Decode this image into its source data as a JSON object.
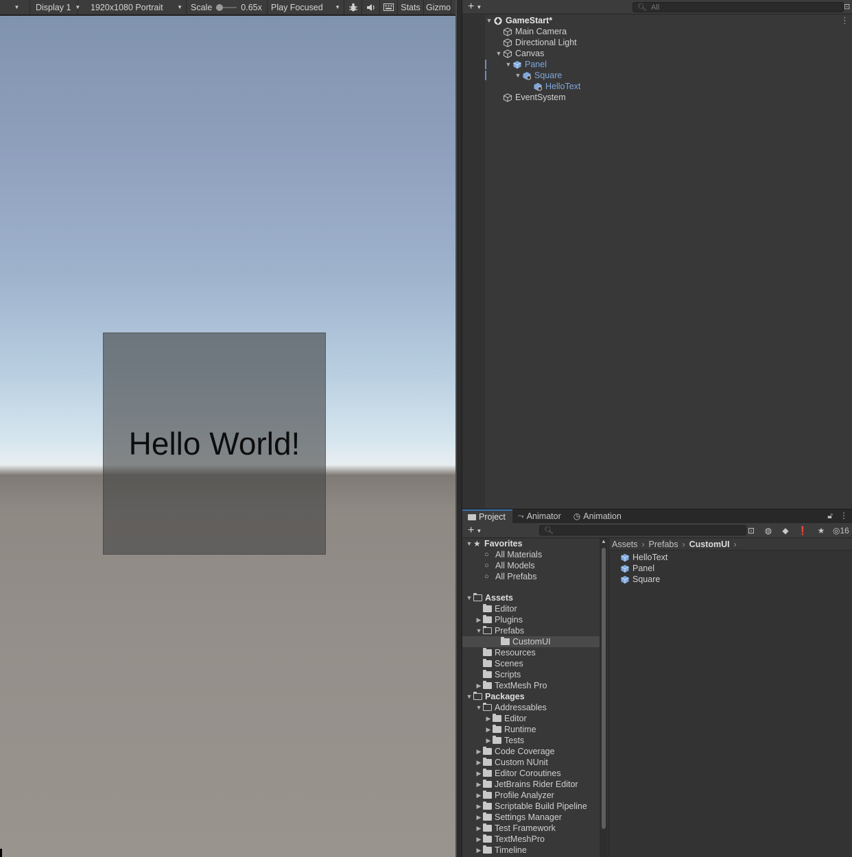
{
  "game_toolbar": {
    "display": "Display 1",
    "resolution": "1920x1080 Portrait",
    "scale_label": "Scale",
    "scale_value": "0.65x",
    "play_mode": "Play Focused",
    "stats": "Stats",
    "gizmos": "Gizmo"
  },
  "game_view": {
    "hello_text": "Hello World!"
  },
  "hierarchy": {
    "search_placeholder": "All",
    "items": [
      {
        "label": "GameStart*"
      },
      {
        "label": "Main Camera"
      },
      {
        "label": "Directional Light"
      },
      {
        "label": "Canvas"
      },
      {
        "label": "Panel"
      },
      {
        "label": "Square"
      },
      {
        "label": "HelloText"
      },
      {
        "label": "EventSystem"
      }
    ]
  },
  "project": {
    "tabs": [
      {
        "label": "Project"
      },
      {
        "label": "Animator"
      },
      {
        "label": "Animation"
      }
    ],
    "visibility_count": "16",
    "tree": [
      {
        "label": "Favorites"
      },
      {
        "label": "All Materials"
      },
      {
        "label": "All Models"
      },
      {
        "label": "All Prefabs"
      },
      {
        "label": "Assets"
      },
      {
        "label": "Editor"
      },
      {
        "label": "Plugins"
      },
      {
        "label": "Prefabs"
      },
      {
        "label": "CustomUI"
      },
      {
        "label": "Resources"
      },
      {
        "label": "Scenes"
      },
      {
        "label": "Scripts"
      },
      {
        "label": "TextMesh Pro"
      },
      {
        "label": "Packages"
      },
      {
        "label": "Addressables"
      },
      {
        "label": "Editor"
      },
      {
        "label": "Runtime"
      },
      {
        "label": "Tests"
      },
      {
        "label": "Code Coverage"
      },
      {
        "label": "Custom NUnit"
      },
      {
        "label": "Editor Coroutines"
      },
      {
        "label": "JetBrains Rider Editor"
      },
      {
        "label": "Profile Analyzer"
      },
      {
        "label": "Scriptable Build Pipeline"
      },
      {
        "label": "Settings Manager"
      },
      {
        "label": "Test Framework"
      },
      {
        "label": "TextMeshPro"
      },
      {
        "label": "Timeline"
      }
    ],
    "breadcrumb": [
      "Assets",
      "Prefabs",
      "CustomUI"
    ],
    "files": [
      {
        "label": "HelloText"
      },
      {
        "label": "Panel"
      },
      {
        "label": "Square"
      }
    ]
  },
  "colors": {
    "selection_text": "#7ea7dc",
    "panel_bg": "#383838",
    "toolbar_bg": "#3c3c3c",
    "active_tab_accent": "#3a72b0"
  }
}
